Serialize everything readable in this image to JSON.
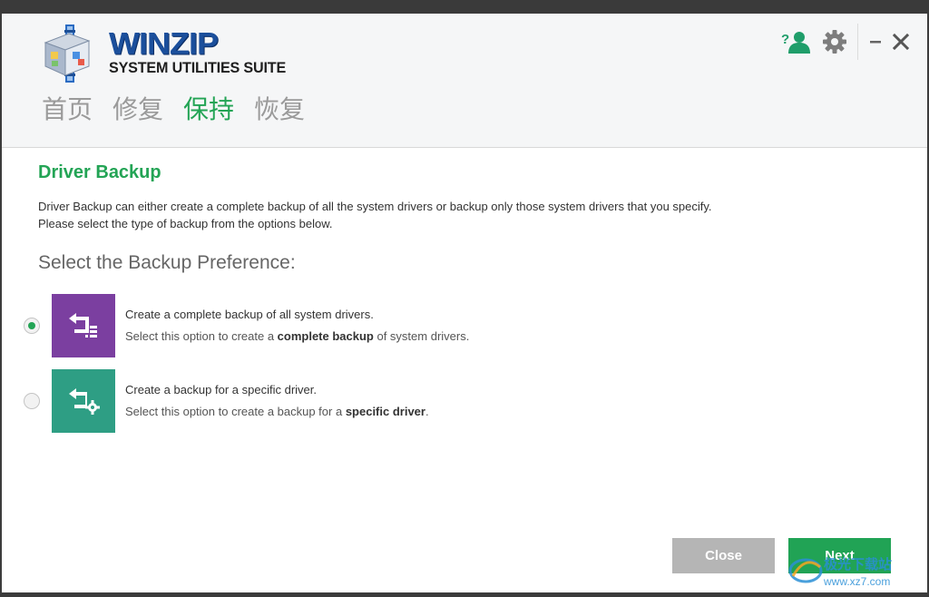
{
  "app": {
    "brand_name": "WINZIP",
    "brand_sub": "SYSTEM UTILITIES SUITE"
  },
  "nav": {
    "tabs": [
      {
        "label": "首页",
        "active": false
      },
      {
        "label": "修复",
        "active": false
      },
      {
        "label": "保持",
        "active": true
      },
      {
        "label": "恢复",
        "active": false
      }
    ]
  },
  "toolbar": {
    "help_icon": "user-help-icon",
    "settings_icon": "gear-icon",
    "minimize_label": "–",
    "close_label": "✕"
  },
  "page": {
    "title": "Driver Backup",
    "desc_line1": "Driver Backup can either create a complete backup of all the system drivers or backup only those system drivers that you specify.",
    "desc_line2": "Please select the type of backup from the options below.",
    "pref_title": "Select the Backup Preference:"
  },
  "options": [
    {
      "title": "Create a complete backup of all system drivers.",
      "sub_prefix": "Select this option to create a ",
      "sub_bold": "complete backup",
      "sub_suffix": " of system drivers.",
      "selected": true,
      "tile_color": "#7b3fa0",
      "icon": "backup-list-icon"
    },
    {
      "title": "Create a backup for a specific driver.",
      "sub_prefix": "Select this option to create a backup for a ",
      "sub_bold": "specific driver",
      "sub_suffix": ".",
      "selected": false,
      "tile_color": "#2e9e84",
      "icon": "backup-gear-icon"
    }
  ],
  "buttons": {
    "close_label": "Close",
    "next_label": "Next"
  },
  "colors": {
    "accent": "#23a455",
    "brand_blue": "#1b4f9c"
  },
  "watermark": {
    "line1": "极光下载站",
    "line2": "www.xz7.com"
  }
}
